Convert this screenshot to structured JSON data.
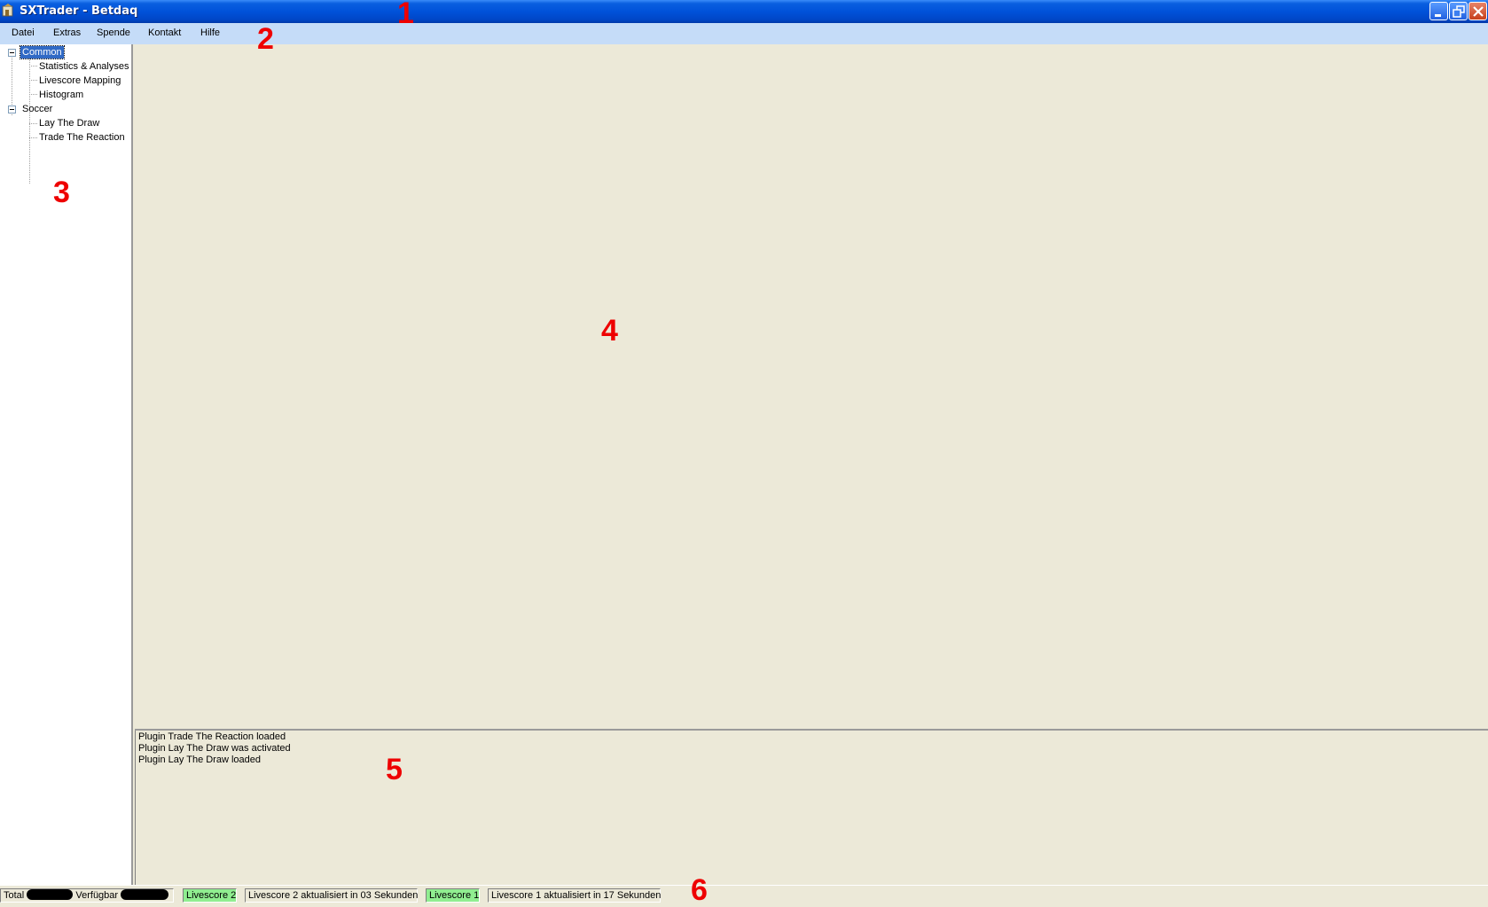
{
  "window": {
    "title": "SXTrader - Betdaq"
  },
  "annotations": [
    "1",
    "2",
    "3",
    "4",
    "5",
    "6"
  ],
  "menu": {
    "items": [
      "Datei",
      "Extras",
      "Spende",
      "Kontakt",
      "Hilfe"
    ]
  },
  "tree": {
    "groups": [
      {
        "label": "Common",
        "selected": true,
        "children": [
          "Statistics & Analyses",
          "Livescore Mapping",
          "Histogram"
        ]
      },
      {
        "label": "Soccer",
        "selected": false,
        "children": [
          "Lay The Draw",
          "Trade The Reaction"
        ]
      }
    ]
  },
  "log": {
    "lines": [
      "Plugin Trade The Reaction loaded",
      "Plugin Lay The Draw was activated",
      "Plugin Lay The Draw loaded"
    ]
  },
  "statusbar": {
    "total_label": "Total",
    "available_label": "Verfügbar",
    "livescore2_label": "Livescore 2",
    "livescore2_status": "Livescore 2 aktualisiert in 03 Sekunden",
    "livescore1_label": "Livescore 1",
    "livescore1_status": "Livescore 1 aktualisiert in 17 Sekunden"
  },
  "colors": {
    "titlebar": "#0052d9",
    "menubar": "#c5dcf8",
    "background": "#ece9d8",
    "selection": "#316ac5",
    "livescore_ok": "#90ee90",
    "annotation": "#ee0000"
  }
}
